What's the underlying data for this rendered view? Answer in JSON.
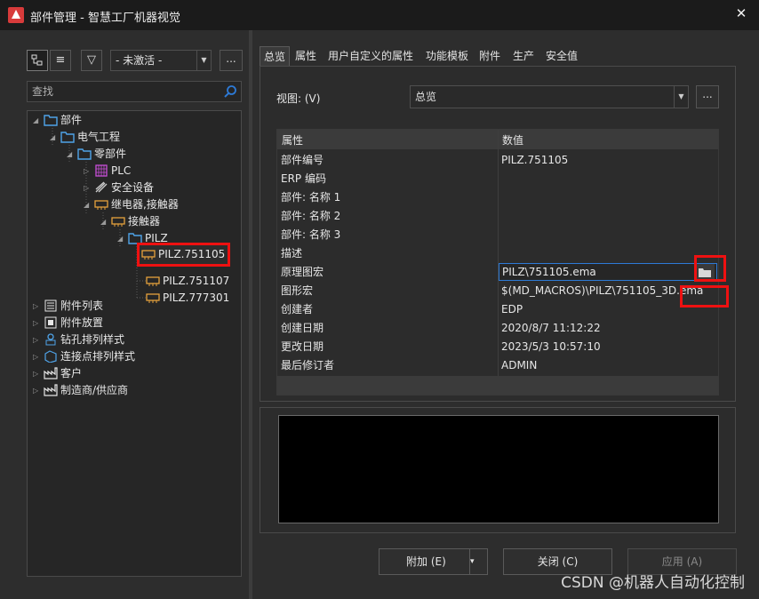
{
  "window": {
    "title": "部件管理 - 智慧工厂机器视觉",
    "close_glyph": "✕"
  },
  "toolbar": {
    "list_glyph": "≡",
    "filter_glyph": "▽",
    "filter_scheme": "- 未激活 -",
    "more_label": "..."
  },
  "search": {
    "placeholder": "查找"
  },
  "tree": {
    "items": [
      {
        "label": "部件",
        "toggle": "◢"
      },
      {
        "label": "电气工程",
        "toggle": "◢"
      },
      {
        "label": "零部件",
        "toggle": "◢"
      },
      {
        "label": "PLC",
        "toggle": "▷"
      },
      {
        "label": "安全设备",
        "toggle": "▷"
      },
      {
        "label": "继电器,接触器",
        "toggle": "◢"
      },
      {
        "label": "接触器",
        "toggle": "◢"
      },
      {
        "label": "PILZ",
        "toggle": "◢"
      },
      {
        "label": "PILZ.751105",
        "toggle": ""
      },
      {
        "label": "PILZ.751107",
        "toggle": ""
      },
      {
        "label": "PILZ.777301",
        "toggle": ""
      },
      {
        "label": "附件列表",
        "toggle": "▷"
      },
      {
        "label": "附件放置",
        "toggle": "▷"
      },
      {
        "label": "钻孔排列样式",
        "toggle": "▷"
      },
      {
        "label": "连接点排列样式",
        "toggle": "▷"
      },
      {
        "label": "客户",
        "toggle": "▷"
      },
      {
        "label": "制造商/供应商",
        "toggle": "▷"
      }
    ]
  },
  "tabs": [
    "总览",
    "属性",
    "用户自定义的属性",
    "功能模板",
    "附件",
    "生产",
    "安全值"
  ],
  "view": {
    "label": "视图: (V)",
    "value": "总览",
    "more_label": "..."
  },
  "properties": {
    "header_name": "属性",
    "header_value": "数值",
    "rows": [
      {
        "name": "部件编号",
        "value": "PILZ.751105"
      },
      {
        "name": "ERP 编码",
        "value": ""
      },
      {
        "name": "部件: 名称 1",
        "value": ""
      },
      {
        "name": "部件: 名称 2",
        "value": ""
      },
      {
        "name": "部件: 名称 3",
        "value": ""
      },
      {
        "name": "描述",
        "value": ""
      },
      {
        "name": "原理图宏",
        "value": "PILZ\\751105.ema"
      },
      {
        "name": "图形宏",
        "value": "$(MD_MACROS)\\PILZ\\751105_3D.ema"
      },
      {
        "name": "创建者",
        "value": "EDP"
      },
      {
        "name": "创建日期",
        "value": "2020/8/7 11:12:22"
      },
      {
        "name": "更改日期",
        "value": "2023/5/3 10:57:10"
      },
      {
        "name": "最后修订者",
        "value": "ADMIN"
      }
    ]
  },
  "buttons": {
    "add": "附加 (E)",
    "add_arrow": "▾",
    "close": "关闭 (C)",
    "apply": "应用 (A)"
  },
  "watermark": "CSDN @机器人自动化控制",
  "colors": {
    "highlight": "#ee1111",
    "edit_border": "#2d7ad6",
    "app_icon": "#d83b3b"
  }
}
